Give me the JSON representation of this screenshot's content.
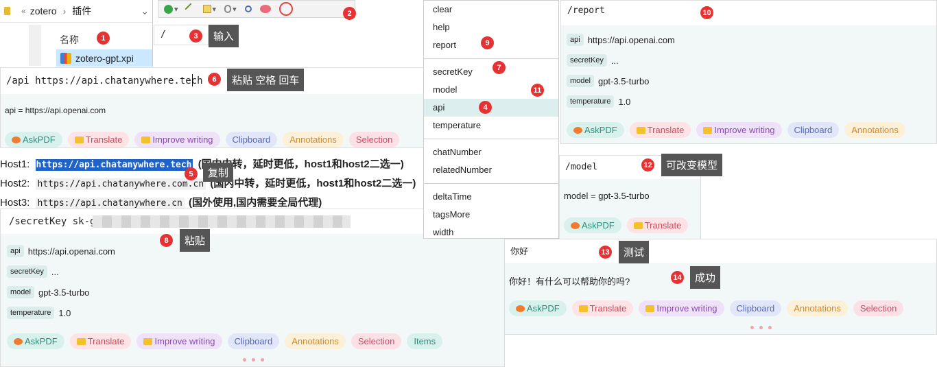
{
  "explorer": {
    "path_sep": "«",
    "crumb1": "zotero",
    "crumb_arrow": "›",
    "crumb2": "插件",
    "dropdown": "⌄",
    "col_header": "名称",
    "file": "zotero-gpt.xpi"
  },
  "slash_input": "/",
  "api_input": "/api https://api.chatanywhere.tech",
  "api_result": "api = https://api.openai.com",
  "chips": {
    "askpdf": "AskPDF",
    "translate": "Translate",
    "improve": "Improve writing",
    "clipboard": "Clipboard",
    "annotations": "Annotations",
    "selection": "Selection",
    "items": "Items"
  },
  "hosts": [
    {
      "label": "Host1:",
      "url": "https://api.chatanywhere.tech",
      "note": "(国内中转，延时更低，host1和host2二选一)"
    },
    {
      "label": "Host2:",
      "url": "https://api.chatanywhere.com.cn",
      "note": "(国内中转，延时更低，host1和host2二选一)"
    },
    {
      "label": "Host3:",
      "url": "https://api.chatanywhere.cn",
      "note": "(国外使用,国内需要全局代理)"
    }
  ],
  "secret_input": "/secretKey sk-g",
  "settings": [
    {
      "key": "api",
      "value": "https://api.openai.com"
    },
    {
      "key": "secretKey",
      "value": "..."
    },
    {
      "key": "model",
      "value": "gpt-3.5-turbo"
    },
    {
      "key": "temperature",
      "value": "1.0"
    }
  ],
  "menu": {
    "group1": [
      "clear",
      "help",
      "report"
    ],
    "group2": [
      "secretKey",
      "model",
      "api",
      "temperature"
    ],
    "group3": [
      "chatNumber",
      "relatedNumber"
    ],
    "group4": [
      "deltaTime",
      "tagsMore",
      "width"
    ],
    "highlighted": "api"
  },
  "report_input": "/report",
  "model_input": "/model",
  "model_result": "model = gpt-3.5-turbo",
  "hello_input": "你好",
  "hello_reply": "你好！有什么可以帮助你的吗?",
  "callouts": {
    "input": "输入",
    "paste_space_enter": "粘贴 空格 回车",
    "copy": "复制",
    "paste": "粘贴",
    "change_model": "可改变模型",
    "test": "测试",
    "success": "成功"
  },
  "badges": [
    "1",
    "2",
    "3",
    "4",
    "5",
    "6",
    "7",
    "8",
    "9",
    "10",
    "11",
    "12",
    "13",
    "14"
  ],
  "colors": {
    "badge": "#e63232",
    "callout": "#555555",
    "highlight": "#dcefee"
  }
}
